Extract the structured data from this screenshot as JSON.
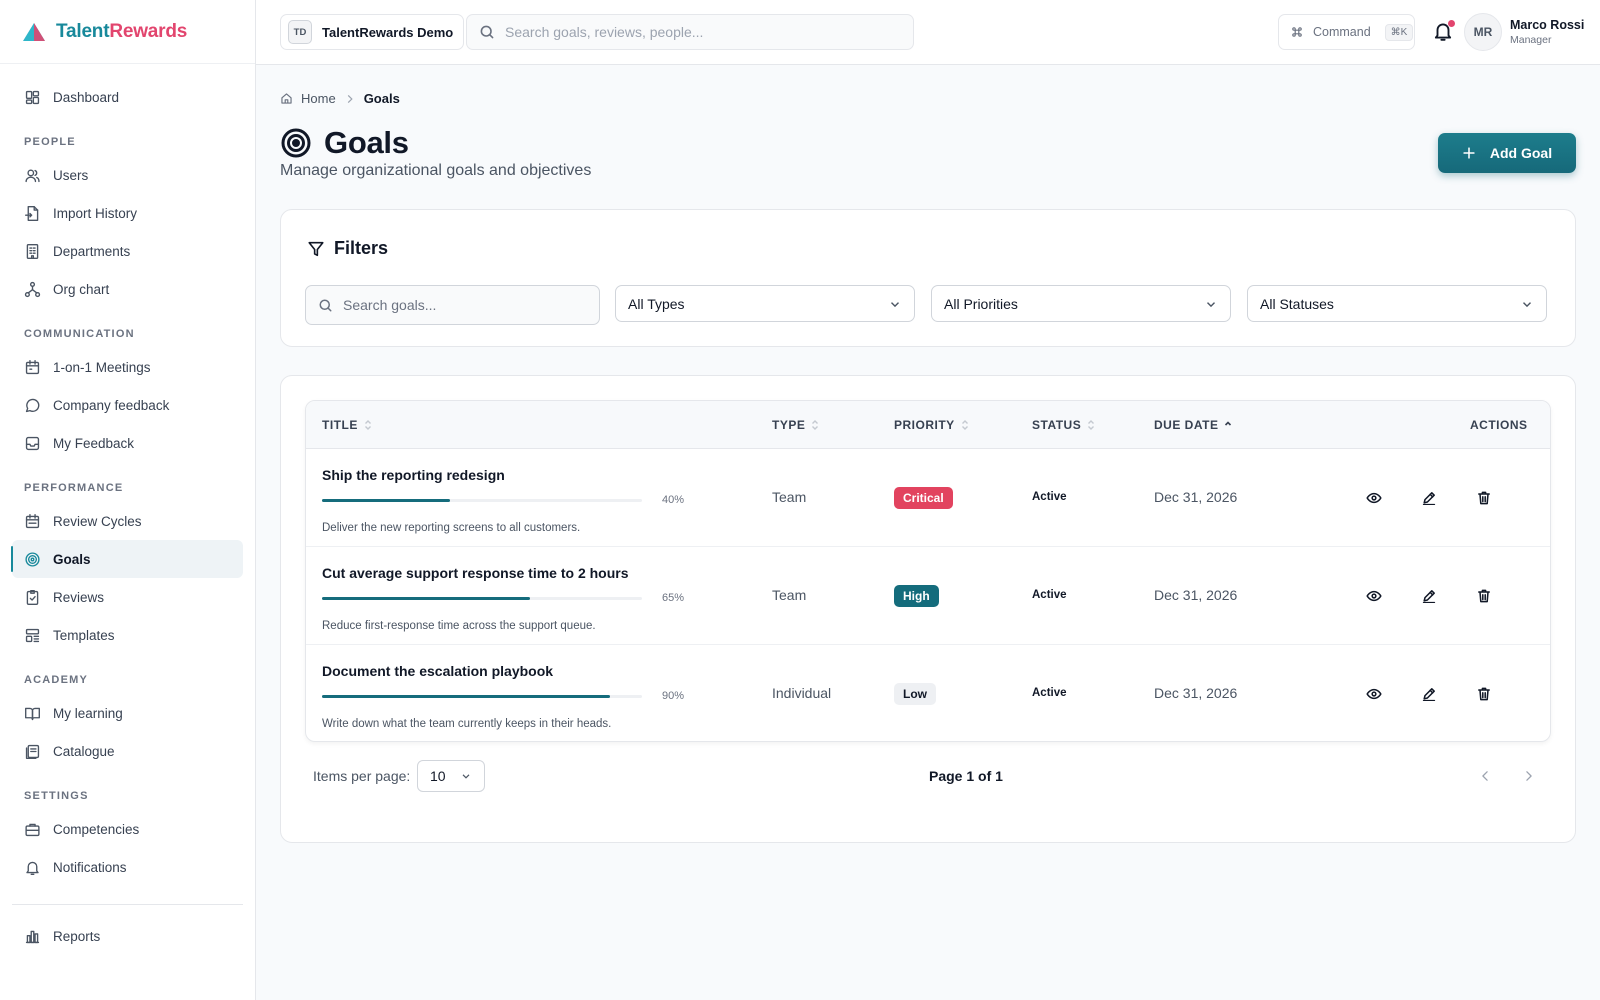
{
  "app": {
    "brand_part1": "Talent",
    "brand_part2": "Rewards",
    "brand_colors": {
      "primary": "#18899b",
      "accent": "#e2456e"
    }
  },
  "header": {
    "org_initials": "TD",
    "org_name": "TalentRewards Demo",
    "search_placeholder": "Search goals, reviews, people...",
    "command_label": "Command",
    "command_shortcut": "⌘K",
    "notification_unread": true,
    "user": {
      "initials": "MR",
      "name": "Marco Rossi",
      "role": "Manager"
    }
  },
  "sidebar": {
    "dashboard": "Dashboard",
    "sections": [
      {
        "title": "PEOPLE",
        "items": [
          "Users",
          "Import History",
          "Departments",
          "Org chart"
        ]
      },
      {
        "title": "COMMUNICATION",
        "items": [
          "1-on-1 Meetings",
          "Company feedback",
          "My Feedback"
        ]
      },
      {
        "title": "PERFORMANCE",
        "items": [
          "Review Cycles",
          "Goals",
          "Reviews",
          "Templates"
        ]
      },
      {
        "title": "ACADEMY",
        "items": [
          "My learning",
          "Catalogue"
        ]
      },
      {
        "title": "SETTINGS",
        "items": [
          "Competencies",
          "Notifications"
        ]
      }
    ],
    "footer_item": "Reports",
    "active_item": "Goals"
  },
  "breadcrumb": {
    "home": "Home",
    "current": "Goals"
  },
  "page": {
    "title": "Goals",
    "subtitle": "Manage organizational goals and objectives",
    "add_button": "Add Goal"
  },
  "filters": {
    "title": "Filters",
    "search_placeholder": "Search goals...",
    "type_selected": "All Types",
    "priority_selected": "All Priorities",
    "status_selected": "All Statuses"
  },
  "table": {
    "columns": {
      "title": "TITLE",
      "type": "TYPE",
      "priority": "PRIORITY",
      "status": "STATUS",
      "due_date": "DUE DATE",
      "actions": "ACTIONS"
    },
    "sorted_column": "due_date",
    "sort_direction": "ascending",
    "rows": [
      {
        "title": "Ship the reporting redesign",
        "progress": 40,
        "progress_label": "40%",
        "description": "Deliver the new reporting screens to all customers.",
        "type": "Team",
        "priority": "Critical",
        "status": "Active",
        "due_date": "Dec 31, 2026"
      },
      {
        "title": "Cut average support response time to 2 hours",
        "progress": 65,
        "progress_label": "65%",
        "description": "Reduce first-response time across the support queue.",
        "type": "Team",
        "priority": "High",
        "status": "Active",
        "due_date": "Dec 31, 2026"
      },
      {
        "title": "Document the escalation playbook",
        "progress": 90,
        "progress_label": "90%",
        "description": "Write down what the team currently keeps in their heads.",
        "type": "Individual",
        "priority": "Low",
        "status": "Active",
        "due_date": "Dec 31, 2026"
      }
    ],
    "priority_colors": {
      "Critical": {
        "bg": "#e2435f",
        "fg": "#ffffff"
      },
      "High": {
        "bg": "#146c7c",
        "fg": "#ffffff"
      },
      "Low": {
        "bg": "#eef0f3",
        "fg": "#111827"
      }
    }
  },
  "pagination": {
    "items_per_page_label": "Items per page:",
    "items_per_page": "10",
    "page_info": "Page 1 of 1"
  }
}
